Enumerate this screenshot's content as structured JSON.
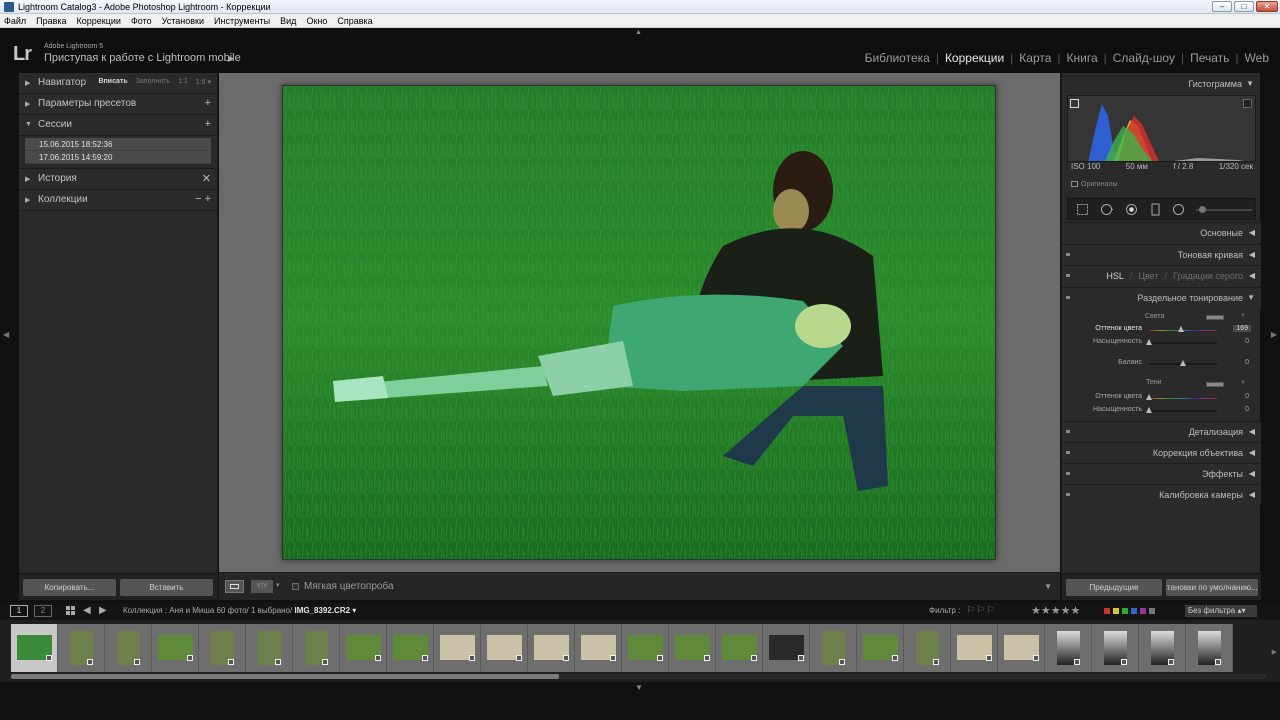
{
  "window": {
    "title": "Lightroom Catalog3 - Adobe Photoshop Lightroom - Коррекции",
    "min": "–",
    "max": "□",
    "close": "✕"
  },
  "menu": [
    "Файл",
    "Правка",
    "Коррекции",
    "Фото",
    "Установки",
    "Инструменты",
    "Вид",
    "Окно",
    "Справка"
  ],
  "identity": {
    "logo": "Lr",
    "version": "Adobe Lightroom 5",
    "mobile": "Приступая к работе с Lightroom mobile",
    "mobile_arrow": "▶"
  },
  "modules": {
    "items": [
      "Библиотека",
      "Коррекции",
      "Карта",
      "Книга",
      "Слайд-шоу",
      "Печать",
      "Web"
    ],
    "active": "Коррекции",
    "separator": "|"
  },
  "left": {
    "navigator": {
      "label": "Навигатор",
      "opts": [
        "Вписать",
        "Заполнить",
        "1:1",
        "1:8 ▾"
      ]
    },
    "presets": {
      "label": "Параметры пресетов",
      "action": "+"
    },
    "sessions": {
      "label": "Сессии",
      "action": "+",
      "items": [
        "15.06.2015 18:52:36",
        "17.06.2015 14:59:20"
      ]
    },
    "history": {
      "label": "История",
      "action": "✕"
    },
    "collections": {
      "label": "Коллекции",
      "action": "− +"
    },
    "copy": "Копировать...",
    "paste": "Вставить"
  },
  "toolbar": {
    "yy": "Y|Y",
    "soft_proof": "Мягкая цветопроба"
  },
  "right": {
    "histogram": {
      "label": "Гистограмма",
      "iso": "ISO 100",
      "focal": "50 мм",
      "aperture": "f / 2.8",
      "shutter": "1/320 сек",
      "originals": "Оригиналы"
    },
    "basic": "Основные",
    "tone_curve": "Тоновая кривая",
    "hsl": {
      "hsl": "HSL",
      "color": "Цвет",
      "gray": "Градации серого",
      "sep": "/"
    },
    "split": {
      "label": "Раздельное тонирование",
      "highlights": "Света",
      "shadows": "Тени",
      "rows": [
        {
          "label": "Оттенок цвета",
          "value": "169",
          "pos": 169,
          "max": 360
        },
        {
          "label": "Насыщенность",
          "value": "0",
          "pos": 0,
          "max": 100
        },
        {
          "label": "Баланс",
          "value": "0",
          "pos": 0.5,
          "max": 1
        },
        {
          "label": "Оттенок цвета",
          "value": "0",
          "pos": 0,
          "max": 360
        },
        {
          "label": "Насыщенность",
          "value": "0",
          "pos": 0,
          "max": 100
        }
      ]
    },
    "detail": "Детализация",
    "lens": "Коррекция объектива",
    "effects": "Эффекты",
    "calibration": "Калибровка камеры",
    "previous": "Предыдущие",
    "defaults": "Установки по умолчанию..."
  },
  "filmstrip": {
    "pages": [
      "1",
      "2"
    ],
    "collection": "Коллекция : Аня и Миша",
    "count": "60 фото/",
    "selected": "1 выбрано/",
    "file": "IMG_8392.CR2 ▾",
    "filter_label": "Фильтр :",
    "flags": "⚐⚐⚐",
    "stars": "★★★★★",
    "no_filter": "Без фильтра  ▴▾"
  },
  "colors": {
    "accent_red": "#c0392b",
    "photo_green": "#2f8a2f"
  }
}
